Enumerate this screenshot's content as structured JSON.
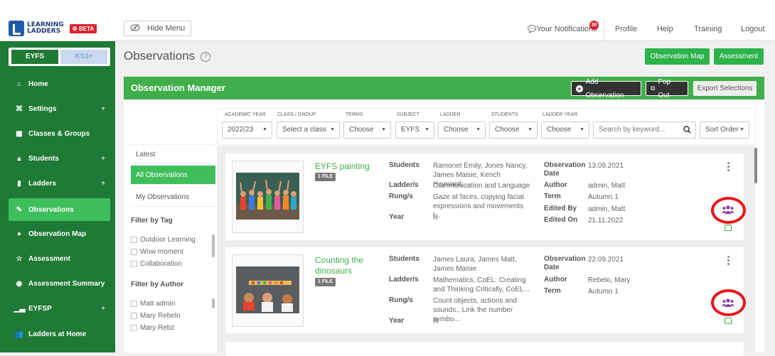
{
  "app": {
    "logo_line1": "LEARNING",
    "logo_line2": "LADDERS",
    "beta": "BETA"
  },
  "topbar": {
    "hide_menu": "Hide Menu",
    "notifications": "Your Notifications",
    "notif_count": "30",
    "profile": "Profile",
    "help": "Help",
    "training": "Training",
    "logout": "Logout"
  },
  "levels": {
    "eyfs": "EYFS",
    "ks1": "KS1+"
  },
  "sidebar": {
    "items": [
      {
        "label": "Home",
        "icon": "home-icon"
      },
      {
        "label": "Settings",
        "icon": "settings-icon",
        "plus": "+"
      },
      {
        "label": "Classes & Groups",
        "icon": "grid-icon"
      },
      {
        "label": "Students",
        "icon": "graduation-cap-icon",
        "plus": "+"
      },
      {
        "label": "Ladders",
        "icon": "book-icon",
        "plus": "+"
      },
      {
        "label": "Observations",
        "icon": "pencil-icon"
      },
      {
        "label": "Observation Map",
        "icon": "map-marker-icon"
      },
      {
        "label": "Assessment",
        "icon": "star-icon"
      },
      {
        "label": "Assessment Summary",
        "icon": "eye-icon"
      },
      {
        "label": "EYFSP",
        "icon": "chart-icon",
        "plus": "+"
      },
      {
        "label": "Ladders at Home",
        "icon": "users-icon"
      }
    ]
  },
  "page": {
    "title": "Observations",
    "help": "?",
    "obs_map_btn": "Observation Map",
    "assessment_btn": "Assessment"
  },
  "manager": {
    "title": "Observation Manager",
    "add": "Add Observation",
    "popout": "Pop Out",
    "export": "Export Selections"
  },
  "filters": {
    "labels": [
      "ACADEMIC YEAR",
      "CLASS / GROUP",
      "TERMS",
      "SUBJECT",
      "LADDER",
      "STUDENTS",
      "LADDER YEAR"
    ],
    "academic_year": "2022/23",
    "class_group": "Select a class",
    "terms": "Choose",
    "subject": "EYFS",
    "ladder": "Choose",
    "students": "Choose",
    "ladder_year": "Choose",
    "search_placeholder": "Search by keyword...",
    "sort": "Sort Order"
  },
  "left_filters": {
    "views": [
      "Latest",
      "All Observations",
      "My Observations"
    ],
    "tag_head": "Filter by Tag",
    "tags": [
      "Outdoor Learning",
      "Wow moment",
      "Collaboration"
    ],
    "author_head": "Filter by Author",
    "authors": [
      "Matt admin",
      "Mary Rebelo",
      "Mary Rebz"
    ]
  },
  "field_labels": {
    "students": "Students",
    "ladders": "Ladder/s",
    "rungs": "Rung/s",
    "year": "Year",
    "obs_date": "Observation Date",
    "author": "Author",
    "term": "Term",
    "edited_by": "Edited By",
    "edited_on": "Edited On",
    "file": "1 FILE"
  },
  "observations": [
    {
      "title": "EYFS painting",
      "students": "Ramonet Emily, Jones Nancy, James Maisie, Kench Hayward, ...",
      "ladders": "Communication and Language",
      "rungs": "Gaze at faces, copying facial expressions and movements l...",
      "year": "R",
      "obs_date": "13.09.2021",
      "author": "admin, Matt",
      "term": "Autumn 1",
      "edited_by": "admin, Matt",
      "edited_on": "21.11.2022"
    },
    {
      "title": "Counting the dinosaurs",
      "students": "James Laura, James Matt, James Maisie",
      "ladders": "Mathematics, CoEL: Creating and Thinking Critically, CoEL...",
      "rungs": "Count objects, actions and sounds., Link the number symbo...",
      "year": "R",
      "obs_date": "22.09.2021",
      "author": "Rebelo, Mary",
      "term": "Autumn 1"
    }
  ],
  "colors": {
    "sidebar": "#1e7a34",
    "accent": "#3fae4b",
    "highlight_ring": "#e8141b",
    "people_icon": "#8a3fa0"
  }
}
